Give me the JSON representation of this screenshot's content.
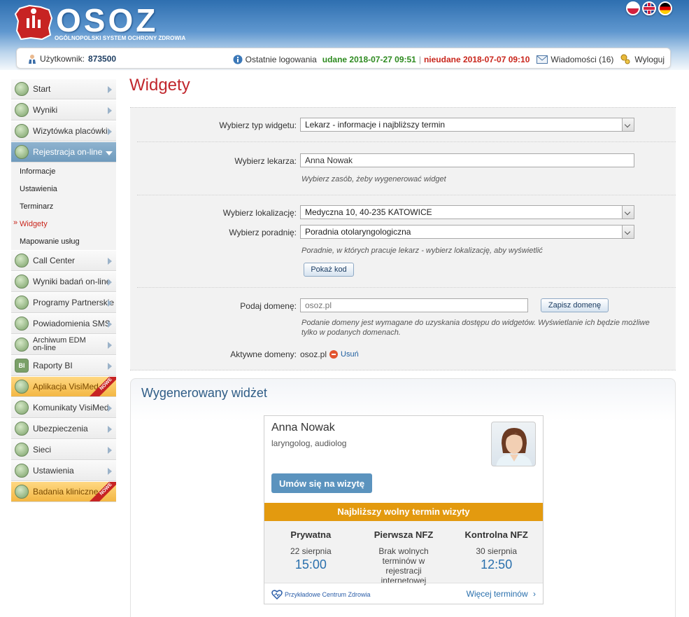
{
  "header": {
    "logo_text": "OSOZ",
    "logo_subtitle": "OGÓLNOPOLSKI SYSTEM OCHRONY ZDROWIA",
    "languages": [
      "pl-flag",
      "en-flag",
      "de-flag"
    ]
  },
  "userbar": {
    "user_label": "Użytkownik:",
    "user_id": "873500",
    "last_login_label": "Ostatnie logowania",
    "success_label": "udane 2018-07-27 09:51",
    "separator": "|",
    "failed_label": "nieudane 2018-07-07 09:10",
    "messages_label": "Wiadomości (16)",
    "logout_label": "Wyloguj"
  },
  "sidebar": {
    "items": [
      {
        "label": "Start",
        "icon": "monitor-icon"
      },
      {
        "label": "Wyniki",
        "icon": "chart-icon"
      },
      {
        "label": "Wizytówka placówki",
        "icon": "globe-icon"
      },
      {
        "label": "Rejestracja on-line",
        "icon": "calendar-icon"
      },
      {
        "label": "Call Center",
        "icon": "phone-icon"
      },
      {
        "label": "Wyniki badań on-line",
        "icon": "flask-icon"
      },
      {
        "label": "Programy Partnerskie",
        "icon": "handshake-icon"
      },
      {
        "label": "Powiadomienia SMS",
        "icon": "sms-icon"
      },
      {
        "label": "Archiwum EDM on-line",
        "icon": "archive-icon"
      },
      {
        "label": "Raporty BI",
        "icon": "bi-icon",
        "badge_text": "BI"
      },
      {
        "label": "Aplikacja VisiMed",
        "icon": "app-icon",
        "ribbon": "NOWE"
      },
      {
        "label": "Komunikaty VisiMed",
        "icon": "message-icon"
      },
      {
        "label": "Ubezpieczenia",
        "icon": "umbrella-icon"
      },
      {
        "label": "Sieci",
        "icon": "network-icon"
      },
      {
        "label": "Ustawienia",
        "icon": "gears-icon"
      },
      {
        "label": "Badania kliniczne",
        "icon": "pill-icon",
        "ribbon": "NOWE"
      }
    ],
    "subitems": [
      "Informacje",
      "Ustawienia",
      "Terminarz",
      "Widgety",
      "Mapowanie usług"
    ]
  },
  "main": {
    "title": "Widgety",
    "form": {
      "widget_type_label": "Wybierz typ widgetu:",
      "widget_type_value": "Lekarz - informacje i najbliższy termin",
      "doctor_label": "Wybierz lekarza:",
      "doctor_value": "Anna Nowak",
      "doctor_hint": "Wybierz zasób, żeby wygenerować widget",
      "location_label": "Wybierz lokalizację:",
      "location_value": "Medyczna 10, 40-235 KATOWICE",
      "clinic_label": "Wybierz poradnię:",
      "clinic_value": "Poradnia otolaryngologiczna",
      "clinic_hint": "Poradnie, w których pracuje lekarz - wybierz lokalizację, aby wyświetlić",
      "show_code_button": "Pokaż kod",
      "domain_label": "Podaj domenę:",
      "domain_placeholder": "osoz.pl",
      "save_domain_button": "Zapisz domenę",
      "domain_hint": "Podanie domeny jest wymagane do uzyskania dostępu do widgetów. Wyświetlanie ich będzie możliwe tylko w podanych domenach.",
      "active_domains_label": "Aktywne domeny:",
      "active_domain": "osoz.pl",
      "remove_label": "Usuń"
    },
    "generated": {
      "title": "Wygenerowany widżet",
      "widget": {
        "name": "Anna Nowak",
        "specialty": "laryngolog, audiolog",
        "book_button": "Umów się na wizytę",
        "band": "Najbliższy wolny termin wizyty",
        "slots": [
          {
            "title": "Prywatna",
            "date": "22 sierpnia",
            "time": "15:00"
          },
          {
            "title": "Pierwsza NFZ",
            "note": "Brak wolnych terminów w rejestracji internetowej"
          },
          {
            "title": "Kontrolna NFZ",
            "date": "30 sierpnia",
            "time": "12:50"
          }
        ],
        "brand": "Przykładowe Centrum Zdrowia",
        "more_link": "Więcej terminów",
        "more_chevron": "›"
      }
    }
  },
  "colors": {
    "title_red": "#c1272d",
    "band_orange": "#e39a0f",
    "button_blue": "#5b93be",
    "active_nav": "#7fa7c6",
    "promo_nav": "#f3b744"
  }
}
